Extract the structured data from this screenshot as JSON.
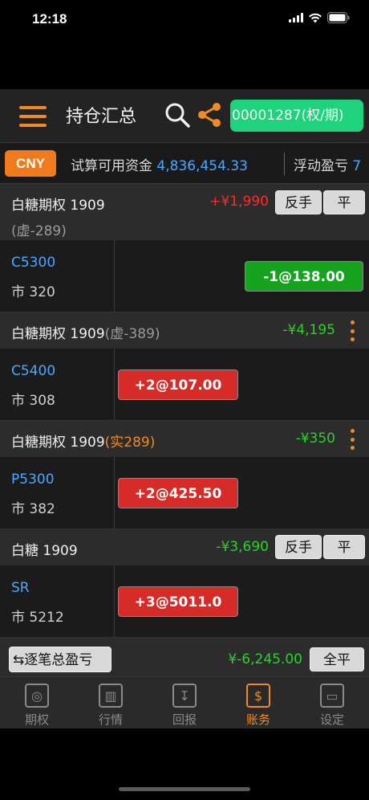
{
  "status_bar": {
    "time": "12:18"
  },
  "nav": {
    "title": "持仓汇总",
    "account": "00001287(权/期)"
  },
  "funds": {
    "currency": "CNY",
    "available_label": "试算可用资金",
    "available_value": "4,836,454.33",
    "float_label": "浮动盈亏",
    "float_value": "7"
  },
  "groups": [
    {
      "name": "白糖期权 1909",
      "note": "(虚-289)",
      "pnl": "+¥1,990",
      "reverse_label": "反手",
      "close_label": "平",
      "code": "C5300",
      "market": "市 320",
      "order": "-1@138.00"
    },
    {
      "name": "白糖期权 1909",
      "note": "(虚-389)",
      "pnl": "-¥4,195",
      "code": "C5400",
      "market": "市 308",
      "order": "+2@107.00"
    },
    {
      "name": "白糖期权 1909",
      "note": "(实289)",
      "pnl": "-¥350",
      "code": "P5300",
      "market": "市 382",
      "order": "+2@425.50"
    },
    {
      "name": "白糖 1909",
      "pnl": "-¥3,690",
      "reverse_label": "反手",
      "close_label": "平",
      "code": "SR",
      "market": "市 5212",
      "order": "+3@5011.0"
    }
  ],
  "total": {
    "detail_label": "逐笔总盈亏",
    "value": "¥-6,245.00",
    "close_all_label": "全平"
  },
  "tabs": [
    {
      "label": "期权",
      "icon": "target-icon"
    },
    {
      "label": "行情",
      "icon": "chart-icon"
    },
    {
      "label": "回报",
      "icon": "report-icon"
    },
    {
      "label": "账务",
      "icon": "account-icon",
      "active": true
    },
    {
      "label": "设定",
      "icon": "settings-icon"
    }
  ],
  "colors": {
    "accent": "#f08a24",
    "account_green": "#1ed37b",
    "profit_red": "#ff2a2a",
    "loss_green": "#28d228",
    "value_blue": "#4aa8ff"
  }
}
